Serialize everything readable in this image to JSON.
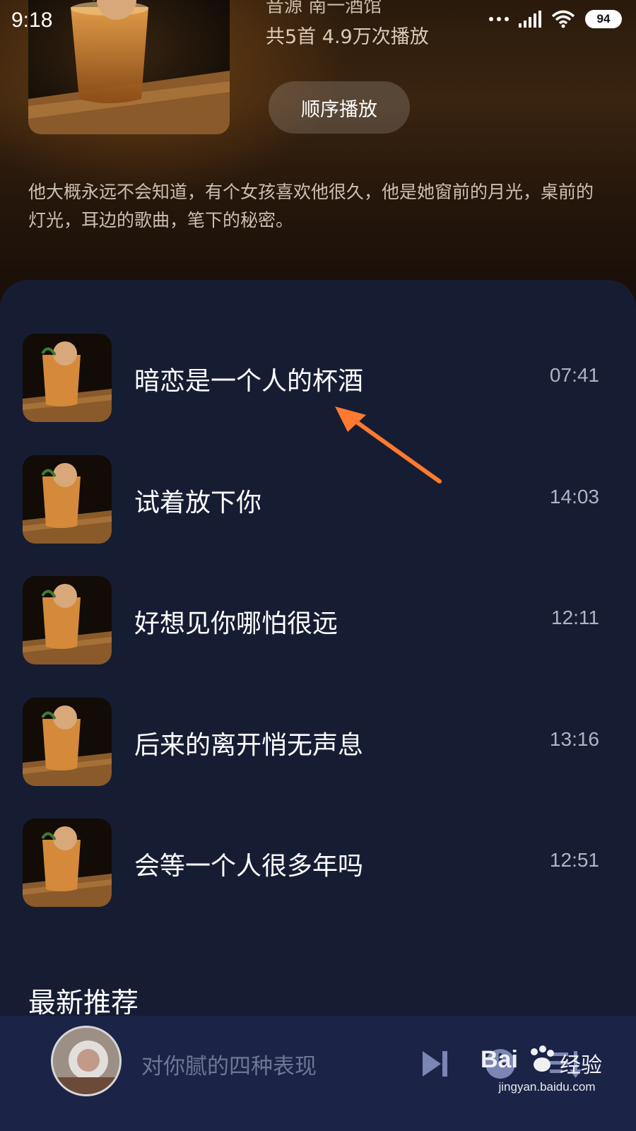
{
  "status_bar": {
    "time": "9:18",
    "battery": "94"
  },
  "album": {
    "source": "音源  南一酒馆",
    "stats": "共5首   4.9万次播放",
    "play_order_label": "顺序播放",
    "description": "他大概永远不会知道，有个女孩喜欢他很久，他是她窗前的月光，桌前的灯光，耳边的歌曲，笔下的秘密。"
  },
  "songs": [
    {
      "title": "暗恋是一个人的杯酒",
      "duration": "07:41"
    },
    {
      "title": "试着放下你",
      "duration": "14:03"
    },
    {
      "title": "好想见你哪怕很远",
      "duration": "12:11"
    },
    {
      "title": "后来的离开悄无声息",
      "duration": "13:16"
    },
    {
      "title": "会等一个人很多年吗",
      "duration": "12:51"
    }
  ],
  "section": {
    "title": "最新推荐"
  },
  "mini_player": {
    "title": "对你腻的四种表现",
    "icons": [
      "next-icon",
      "clock-icon",
      "playlist-icon"
    ]
  },
  "watermark": {
    "logo": "Bai",
    "logo2": "经验",
    "url": "jingyan.baidu.com"
  },
  "colors": {
    "arrow": "#ff7a2e",
    "sheet": "#161d33",
    "mini_player": "#1b2447"
  }
}
